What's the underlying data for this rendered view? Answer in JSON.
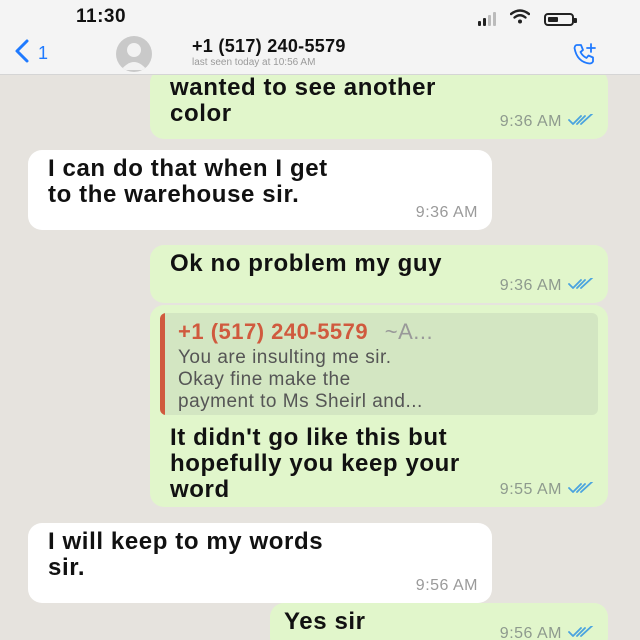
{
  "status_bar": {
    "time": "11:30",
    "icons": [
      "signal-icon",
      "wifi-icon",
      "battery-icon"
    ],
    "battery_level": 0.45
  },
  "header": {
    "back_icon": "chevron-left-icon",
    "back_count": "1",
    "avatar_icon": "person-placeholder-icon",
    "contact_name": "+1 (517) 240-5579",
    "last_seen": "last seen today at 10:56 AM",
    "call_icon": "add-call-icon",
    "accent_color": "#1f7aff"
  },
  "colors": {
    "outgoing_bubble": "#e1f6cb",
    "incoming_bubble": "#ffffff",
    "chat_background": "#e6e3de",
    "quote_accent": "#d05a3e",
    "read_ticks": "#4aa3df"
  },
  "messages": [
    {
      "direction": "outgoing",
      "text": "wanted to see another\ncolor",
      "time": "9:36 AM",
      "status": "read"
    },
    {
      "direction": "incoming",
      "text": "I can do that when I get\nto the warehouse sir.",
      "time": "9:36 AM"
    },
    {
      "direction": "outgoing",
      "text": "Ok no problem my guy",
      "time": "9:36 AM",
      "status": "read"
    },
    {
      "direction": "outgoing",
      "quote": {
        "author": "+1 (517) 240-5579",
        "author_suffix": "~A...",
        "text": "You are insulting me sir.\nOkay fine make the\npayment to Ms Sheirl and..."
      },
      "text": "It didn't go like this but\nhopefully you keep your\nword",
      "time": "9:55 AM",
      "status": "read"
    },
    {
      "direction": "incoming",
      "text": "I will keep to my words\nsir.",
      "time": "9:56 AM"
    },
    {
      "direction": "outgoing",
      "text": "Yes sir",
      "time": "9:56 AM",
      "status": "read"
    }
  ]
}
